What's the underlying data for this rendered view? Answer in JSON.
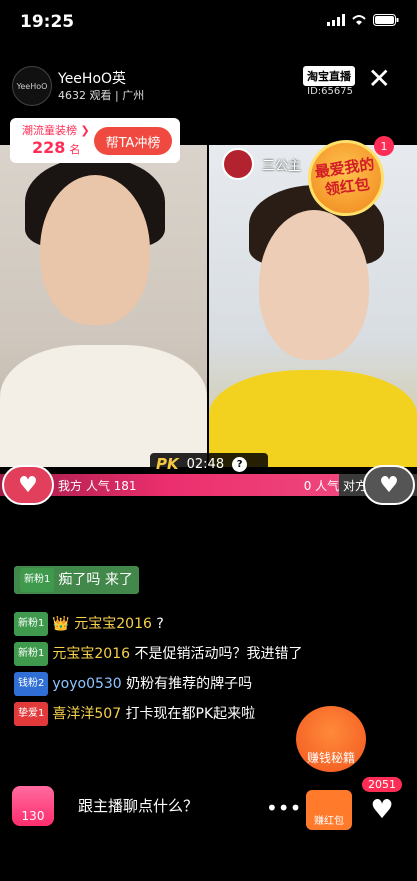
{
  "status": {
    "time": "19:25"
  },
  "header": {
    "avatar_text": "YeeHoO",
    "host_name": "YeeHoO英",
    "host_meta": "4632 观看 | 广州",
    "platform_badge": "淘宝直播",
    "room_id": "ID:65675"
  },
  "rank_card": {
    "title": "潮流童装榜 ❯",
    "rank": "228",
    "rank_unit": "名",
    "button": "帮TA冲榜"
  },
  "guest": {
    "name": "三公主"
  },
  "redpack": {
    "line1": "最爱我的",
    "line2": "领红包",
    "badge": "1"
  },
  "pk": {
    "logo": "PK",
    "time": "02:48",
    "info": "?",
    "left_label": "我方 人气 181",
    "right_label": "0 人气 对方"
  },
  "comments": [
    {
      "badge": "新粉1",
      "badge_type": "new",
      "user": "",
      "text": "痴了吗 来了"
    },
    {
      "badge": "新粉1",
      "badge_type": "new",
      "user": "元宝宝2016",
      "text": "?"
    },
    {
      "badge": "新粉1",
      "badge_type": "new",
      "user": "元宝宝2016",
      "text": "不是促销活动吗？我进错了"
    },
    {
      "badge": "钱粉2",
      "badge_type": "money",
      "user": "yoyo0530",
      "text": "奶粉有推荐的牌子吗"
    },
    {
      "badge": "挚爱1",
      "badge_type": "love",
      "user": "喜洋洋507",
      "text": "打卡现在都PK起来啦"
    }
  ],
  "earn": {
    "label": "赚钱秘籍"
  },
  "bottom": {
    "bag_count": "130",
    "chat_placeholder": "跟主播聊点什么？",
    "more": "•••",
    "redpacket_label": "赚红包",
    "like_count": "2051"
  },
  "colors": {
    "accent": "#ff2d55",
    "pk_bar": "#ec2f6e",
    "gold": "#f5c842"
  }
}
